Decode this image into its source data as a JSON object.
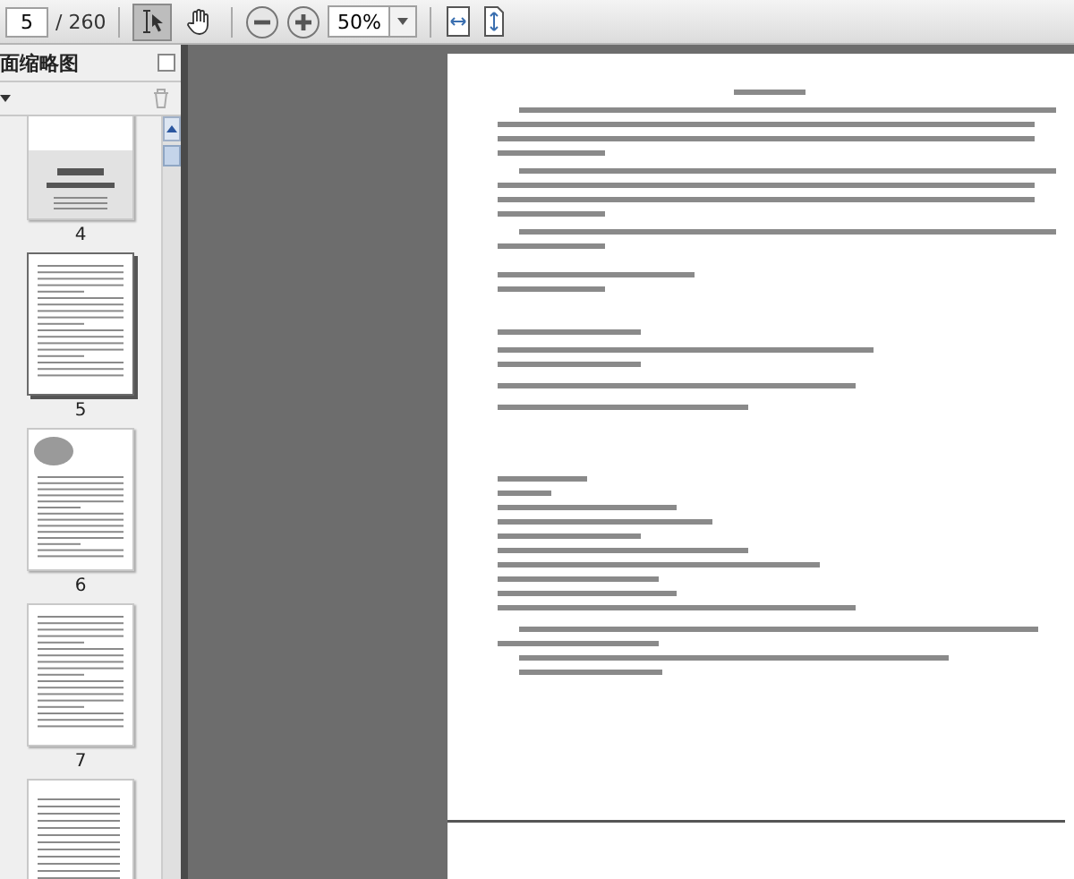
{
  "toolbar": {
    "page_number": "5",
    "page_count": "/ 260",
    "tools": [
      {
        "kind": "select",
        "selected": true
      },
      {
        "kind": "hand",
        "selected": false
      }
    ],
    "zoom": "50%"
  },
  "sidebar": {
    "title": "面缩略图",
    "thumbnails": [
      {
        "label": "4",
        "kind": "cover",
        "selected": false
      },
      {
        "label": "5",
        "kind": "text",
        "selected": true
      },
      {
        "label": "6",
        "kind": "preface",
        "selected": false
      },
      {
        "label": "7",
        "kind": "text",
        "selected": false
      },
      {
        "kind": "contents",
        "selected": false
      }
    ]
  }
}
